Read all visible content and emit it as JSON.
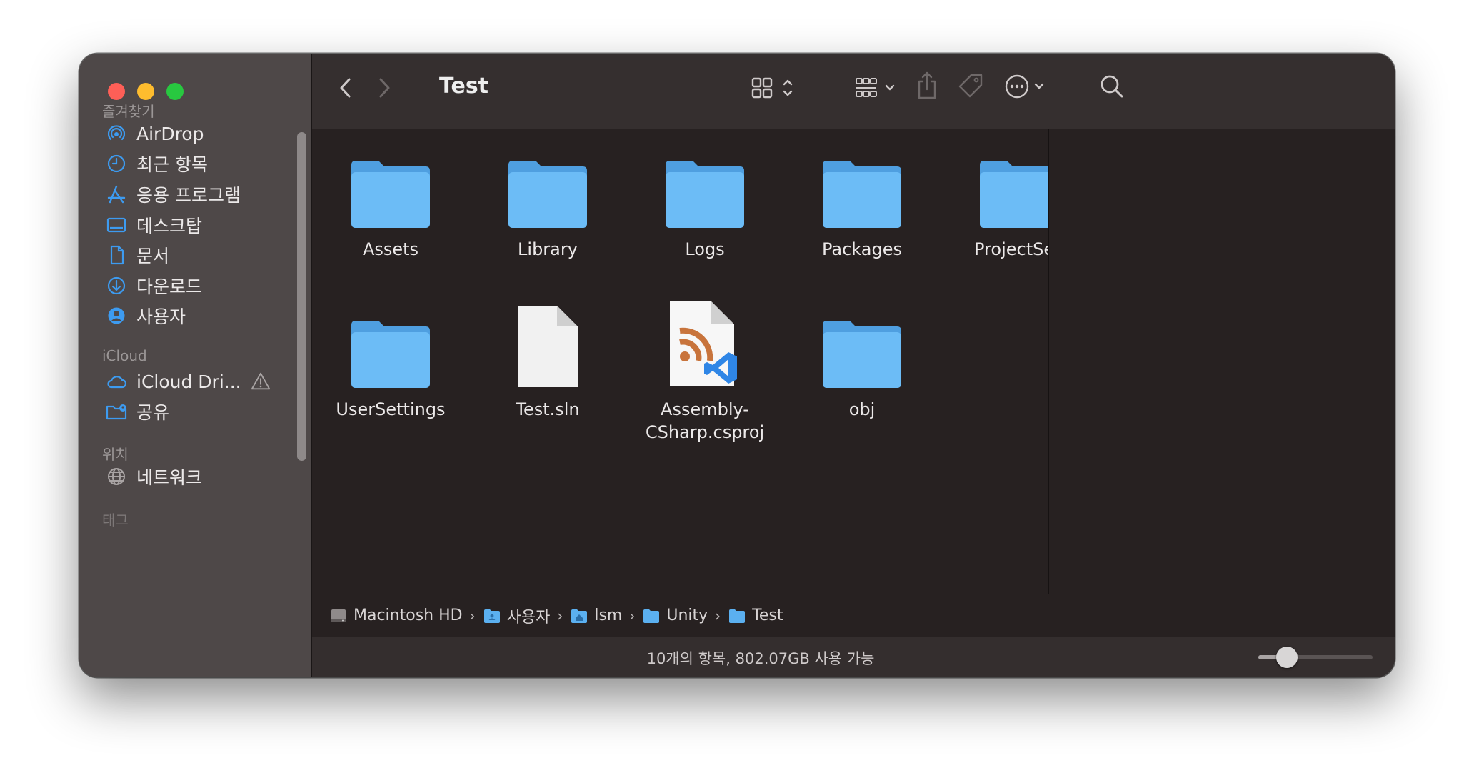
{
  "window": {
    "title": "Test"
  },
  "sidebar": {
    "favorites_label": "즐겨찾기",
    "favorites": [
      {
        "label": "AirDrop",
        "icon": "airdrop-icon"
      },
      {
        "label": "최근 항목",
        "icon": "clock-icon"
      },
      {
        "label": "응용 프로그램",
        "icon": "applications-icon"
      },
      {
        "label": "데스크탑",
        "icon": "desktop-icon"
      },
      {
        "label": "문서",
        "icon": "document-icon"
      },
      {
        "label": "다운로드",
        "icon": "download-icon"
      },
      {
        "label": "사용자",
        "icon": "user-icon"
      }
    ],
    "icloud_label": "iCloud",
    "icloud": [
      {
        "label": "iCloud Dri...",
        "icon": "cloud-icon",
        "warning_icon": "warning-icon"
      },
      {
        "label": "공유",
        "icon": "shared-folder-icon"
      }
    ],
    "locations_label": "위치",
    "locations": [
      {
        "label": "네트워크",
        "icon": "network-icon"
      }
    ],
    "tags_label": "태그"
  },
  "toolbar": {
    "back_icon": "chevron-left-icon",
    "forward_icon": "chevron-right-icon",
    "view_icon": "grid-view-icon",
    "group_icon": "group-icon",
    "share_icon": "share-icon",
    "tag_icon": "tag-icon",
    "more_icon": "ellipsis-circle-icon",
    "search_icon": "search-icon"
  },
  "files": [
    {
      "name": "Assets",
      "kind": "folder"
    },
    {
      "name": "Library",
      "kind": "folder"
    },
    {
      "name": "Logs",
      "kind": "folder"
    },
    {
      "name": "Packages",
      "kind": "folder"
    },
    {
      "name": "ProjectSe",
      "kind": "folder"
    },
    {
      "name": "UserSettings",
      "kind": "folder"
    },
    {
      "name": "Test.sln",
      "kind": "document"
    },
    {
      "name": "Assembly-\nCSharp.csproj",
      "kind": "csproj"
    },
    {
      "name": "obj",
      "kind": "folder"
    }
  ],
  "pathbar": [
    {
      "label": "Macintosh HD",
      "icon": "hard-drive-icon"
    },
    {
      "label": "사용자",
      "icon": "users-folder-icon"
    },
    {
      "label": "lsm",
      "icon": "home-folder-icon"
    },
    {
      "label": "Unity",
      "icon": "folder-icon"
    },
    {
      "label": "Test",
      "icon": "folder-icon"
    }
  ],
  "status": {
    "text": "10개의 항목, 802.07GB 사용 가능",
    "icon_size_level": 0.25
  },
  "colors": {
    "folder": "#68b9f4",
    "accent": "#2f86e6",
    "rss": "#c8743c"
  }
}
